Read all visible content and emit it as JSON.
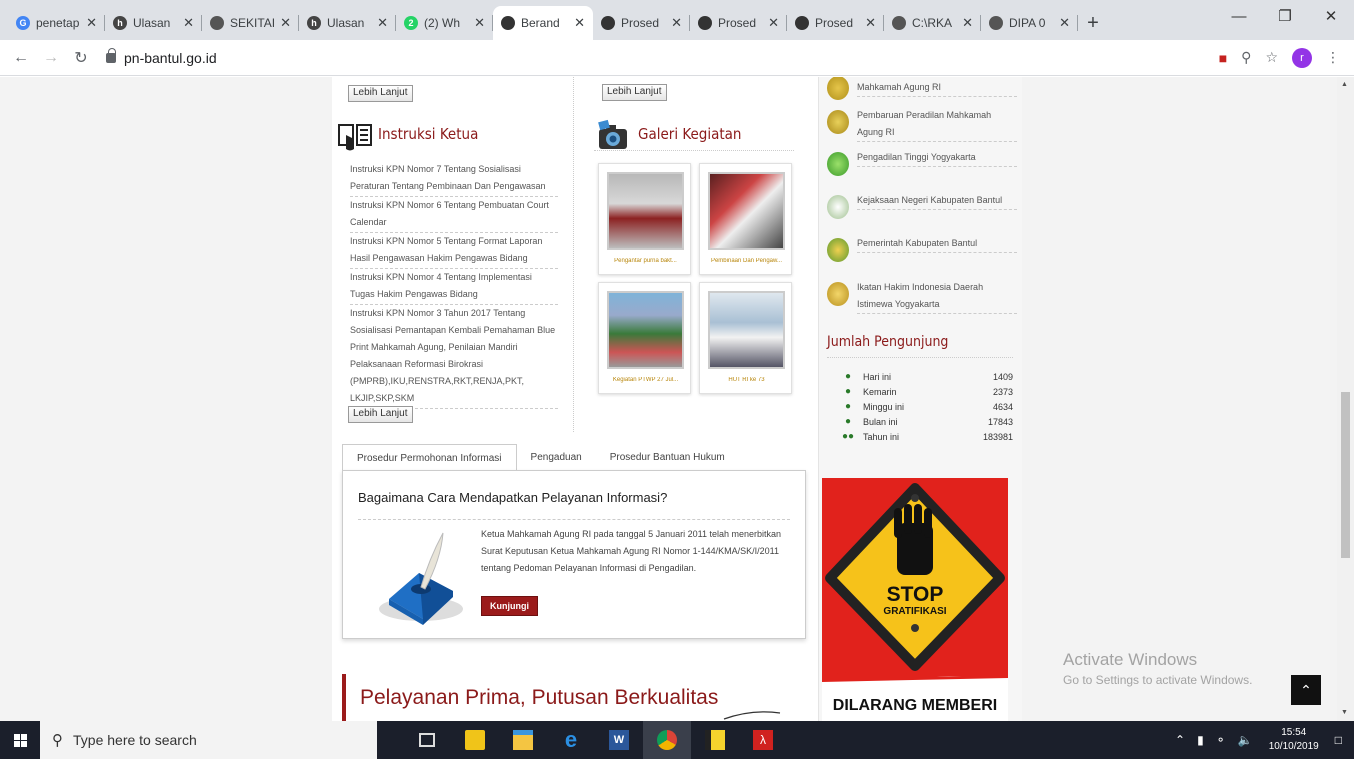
{
  "browser": {
    "tabs": [
      {
        "label": "penetap",
        "icon_color": "#4285f4",
        "glyph": "G",
        "active": false
      },
      {
        "label": "Ulasan",
        "icon_color": "#444444",
        "glyph": "h",
        "active": false
      },
      {
        "label": "SEKITAI",
        "icon_color": "#555555",
        "glyph": "",
        "active": false
      },
      {
        "label": "Ulasan",
        "icon_color": "#444444",
        "glyph": "h",
        "active": false
      },
      {
        "label": "(2) Wh",
        "icon_color": "#25d366",
        "glyph": "2",
        "active": false
      },
      {
        "label": "Berand",
        "icon_color": "#333333",
        "glyph": "",
        "active": true
      },
      {
        "label": "Prosed",
        "icon_color": "#333333",
        "glyph": "",
        "active": false
      },
      {
        "label": "Prosed",
        "icon_color": "#333333",
        "glyph": "",
        "active": false
      },
      {
        "label": "Prosed",
        "icon_color": "#333333",
        "glyph": "",
        "active": false
      },
      {
        "label": "C:\\RKA",
        "icon_color": "#555555",
        "glyph": "",
        "active": false
      },
      {
        "label": "DIPA 0",
        "icon_color": "#555555",
        "glyph": "",
        "active": false
      }
    ],
    "url": "pn-bantul.go.id",
    "profile_initial": "r"
  },
  "page": {
    "more_label": "Lebih Lanjut",
    "instruksi": {
      "title": "Instruksi Ketua",
      "items": [
        "Instruksi KPN Nomor 7 Tentang Sosialisasi Peraturan Tentang Pembinaan Dan Pengawasan",
        "Instruksi KPN Nomor 6 Tentang Pembuatan Court Calendar",
        "Instruksi KPN Nomor 5 Tentang Format Laporan Hasil Pengawasan Hakim Pengawas Bidang",
        "Instruksi KPN Nomor 4 Tentang Implementasi Tugas Hakim Pengawas Bidang",
        "Instruksi KPN Nomor 3 Tahun 2017 Tentang Sosialisasi Pemantapan Kembali Pemahaman Blue Print Mahkamah Agung, Penilaian Mandiri Pelaksanaan Reformasi Birokrasi (PMPRB),IKU,RENSTRA,RKT,RENJA,PKT, LKJIP,SKP,SKM"
      ]
    },
    "galeri": {
      "title": "Galeri Kegiatan",
      "items": [
        {
          "caption": "Pengantar purna bakt..."
        },
        {
          "caption": "Pembinaan Dan Pengaw..."
        },
        {
          "caption": "Kegiatan PTWP 27 Jul..."
        },
        {
          "caption": "HUT RI ke 73"
        }
      ]
    },
    "tabs": [
      "Prosedur Permohonan Informasi",
      "Pengaduan",
      "Prosedur Bantuan Hukum"
    ],
    "panel": {
      "title": "Bagaimana Cara Mendapatkan Pelayanan Informasi?",
      "text": "Ketua Mahkamah Agung RI pada tanggal 5 Januari 2011 telah menerbitkan Surat Keputusan Ketua Mahkamah Agung RI Nomor 1-144/KMA/SK/I/2011 tentang Pedoman Pelayanan Informasi di Pengadilan.",
      "button": "Kunjungi"
    },
    "slogan": "Pelayanan Prima, Putusan Berkualitas",
    "links": [
      "Mahkamah Agung RI",
      "Pembaruan Peradilan Mahkamah Agung RI",
      "Pengadilan Tinggi Yogyakarta",
      "Kejaksaan Negeri Kabupaten Bantul",
      "Pemerintah Kabupaten Bantul",
      "Ikatan Hakim Indonesia Daerah Istimewa Yogyakarta"
    ],
    "pengunjung": {
      "title": "Jumlah Pengunjung",
      "rows": [
        {
          "label": "Hari ini",
          "value": "1409"
        },
        {
          "label": "Kemarin",
          "value": "2373"
        },
        {
          "label": "Minggu ini",
          "value": "4634"
        },
        {
          "label": "Bulan ini",
          "value": "17843"
        },
        {
          "label": "Tahun ini",
          "value": "183981"
        }
      ]
    },
    "banner": {
      "stop": "STOP",
      "grat": "GRATIFIKASI",
      "bottom": "DILARANG MEMBERI"
    }
  },
  "watermark": {
    "line1": "Activate Windows",
    "line2": "Go to Settings to activate Windows."
  },
  "taskbar": {
    "search_placeholder": "Type here to search",
    "time": "15:54",
    "date": "10/10/2019"
  }
}
